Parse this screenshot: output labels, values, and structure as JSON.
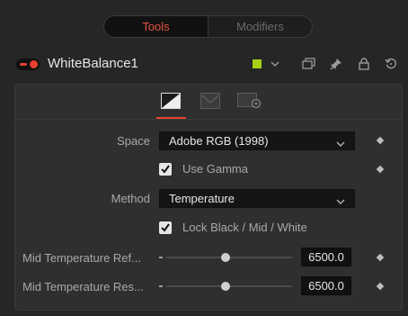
{
  "tabs": [
    {
      "label": "Tools",
      "active": true
    },
    {
      "label": "Modifiers",
      "active": false
    }
  ],
  "header": {
    "tool_name": "WhiteBalance1",
    "color_swatch": "#a8d116",
    "icons": [
      "color-dropdown-chevron-icon",
      "versions-icon",
      "pin-icon",
      "lock-icon",
      "reset-icon"
    ]
  },
  "subtabs": [
    "white-balance-icon",
    "image-icon",
    "settings-icon"
  ],
  "controls": {
    "space": {
      "label": "Space",
      "value": "Adobe RGB (1998)"
    },
    "use_gamma": {
      "label": "Use Gamma",
      "checked": true
    },
    "method": {
      "label": "Method",
      "value": "Temperature"
    },
    "lock": {
      "label": "Lock Black / Mid / White",
      "checked": true
    },
    "mid_ref": {
      "label": "Mid Temperature Ref...",
      "value": "6500.0"
    },
    "mid_res": {
      "label": "Mid Temperature Res...",
      "value": "6500.0"
    }
  },
  "colors": {
    "accent": "#e8402f",
    "tab_active_text": "#e8543d",
    "panel": "#2f2f2f"
  }
}
